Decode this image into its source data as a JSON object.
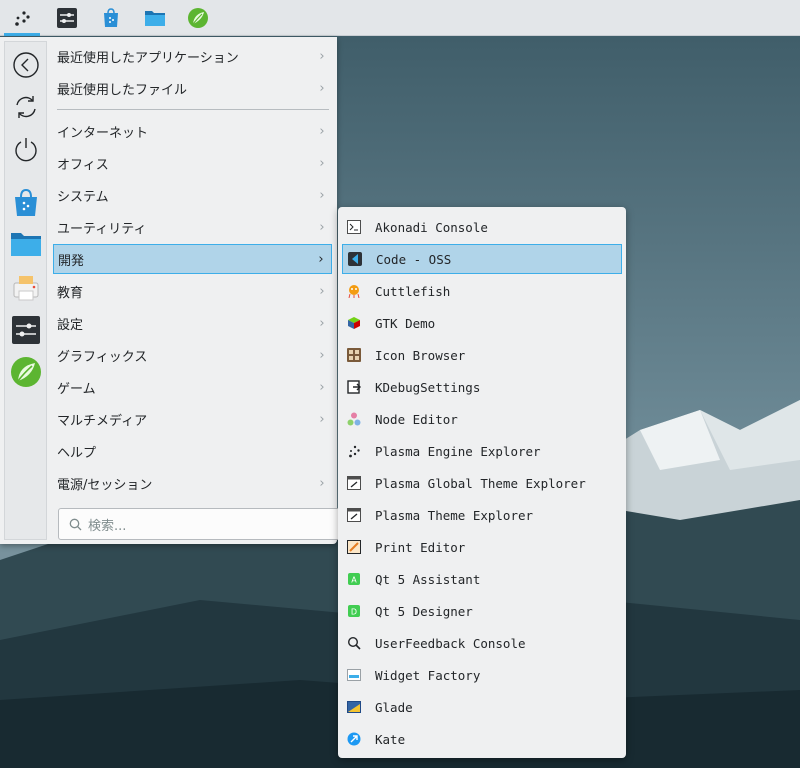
{
  "panel": {
    "icons": [
      "plasma-launcher-icon",
      "system-settings-icon",
      "discover-store-icon",
      "file-manager-icon",
      "leaf-app-icon"
    ]
  },
  "favorites": [
    "back-icon",
    "refresh-icon",
    "power-icon",
    "discover-store-icon",
    "file-manager-icon",
    "printer-icon",
    "system-settings-icon",
    "leaf-app-icon"
  ],
  "menu": {
    "recent_apps": "最近使用したアプリケーション",
    "recent_files": "最近使用したファイル",
    "categories": [
      "インターネット",
      "オフィス",
      "システム",
      "ユーティリティ",
      "開発",
      "教育",
      "設定",
      "グラフィックス",
      "ゲーム",
      "マルチメディア",
      "ヘルプ",
      "電源/セッション"
    ],
    "selected_category": "開発",
    "search_placeholder": "検索..."
  },
  "submenu": {
    "items": [
      "Akonadi Console",
      "Code - OSS",
      "Cuttlefish",
      "GTK Demo",
      "Icon Browser",
      "KDebugSettings",
      "Node Editor",
      "Plasma Engine Explorer",
      "Plasma Global Theme Explorer",
      "Plasma Theme Explorer",
      "Print Editor",
      "Qt 5 Assistant",
      "Qt 5 Designer",
      "UserFeedback Console",
      "Widget Factory",
      "Glade",
      "Kate"
    ],
    "selected_item": "Code - OSS"
  },
  "colors": {
    "accent": "#3daee9",
    "selection_bg": "#b0d4e9",
    "panel_bg": "#e3e6e9",
    "menu_bg": "#eff0f1"
  }
}
